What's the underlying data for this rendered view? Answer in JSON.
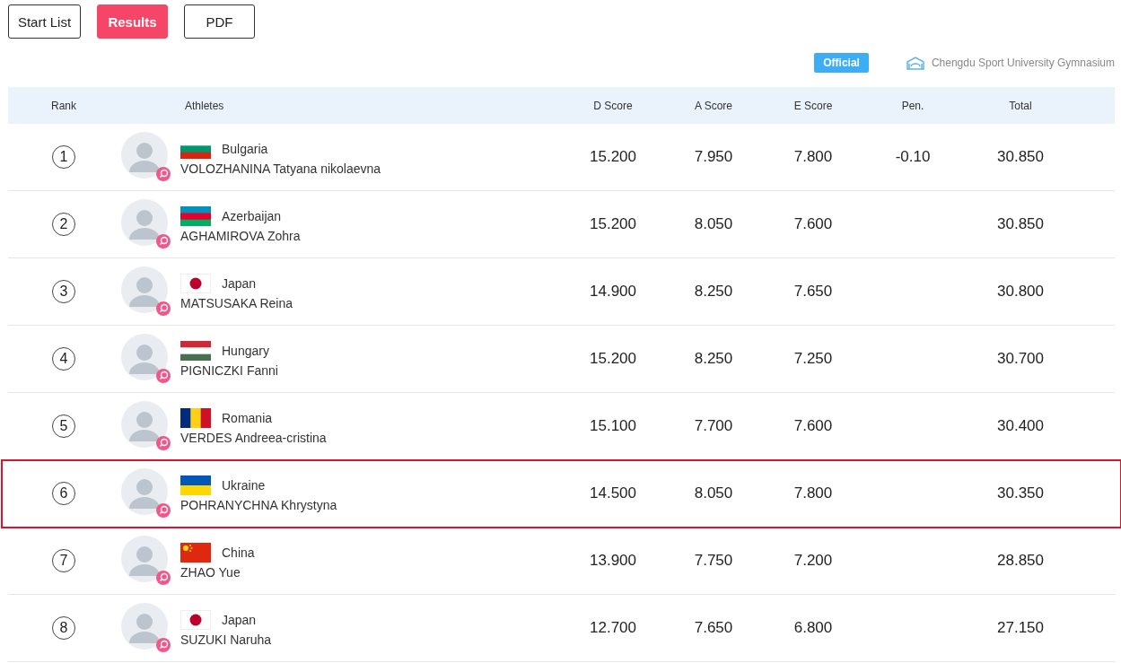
{
  "buttons": [
    {
      "label": "Start List",
      "selected": false
    },
    {
      "label": "Results",
      "selected": true
    },
    {
      "label": "PDF",
      "selected": false
    }
  ],
  "status_badge": "Official",
  "venue": "Chengdu Sport University Gymnasium",
  "table": {
    "columns": [
      "Rank",
      "Athletes",
      "D Score",
      "A Score",
      "E Score",
      "Pen.",
      "Total"
    ],
    "rows": [
      {
        "rank": "1",
        "country": "Bulgaria",
        "kind": "bg",
        "name": "VOLOZHANINA Tatyana nikolaevna",
        "d_score": "15.200",
        "a_score": "7.950",
        "e_score": "7.800",
        "pen": "-0.10",
        "total": "30.850",
        "highlighted": false
      },
      {
        "rank": "2",
        "country": "Azerbaijan",
        "kind": "az",
        "name": "AGHAMIROVA Zohra",
        "d_score": "15.200",
        "a_score": "8.050",
        "e_score": "7.600",
        "total": "30.850",
        "highlighted": false
      },
      {
        "rank": "3",
        "country": "Japan",
        "kind": "jp",
        "name": "MATSUSAKA Reina",
        "d_score": "14.900",
        "a_score": "8.250",
        "e_score": "7.650",
        "total": "30.800",
        "highlighted": false
      },
      {
        "rank": "4",
        "country": "Hungary",
        "kind": "hu",
        "name": "PIGNICZKI Fanni",
        "d_score": "15.200",
        "a_score": "8.250",
        "e_score": "7.250",
        "total": "30.700",
        "highlighted": false
      },
      {
        "rank": "5",
        "country": "Romania",
        "kind": "ro",
        "name": "VERDES Andreea-cristina",
        "d_score": "15.100",
        "a_score": "7.700",
        "e_score": "7.600",
        "total": "30.400",
        "highlighted": false
      },
      {
        "rank": "6",
        "country": "Ukraine",
        "kind": "ua",
        "name": "POHRANYCHNA Khrystyna",
        "d_score": "14.500",
        "a_score": "8.050",
        "e_score": "7.800",
        "total": "30.350",
        "highlighted": true
      },
      {
        "rank": "7",
        "country": "China",
        "kind": "cn",
        "name": "ZHAO Yue",
        "d_score": "13.900",
        "a_score": "7.750",
        "e_score": "7.200",
        "total": "28.850",
        "highlighted": false
      },
      {
        "rank": "8",
        "country": "Japan",
        "kind": "jp",
        "name": "SUZUKI Naruha",
        "d_score": "12.700",
        "a_score": "7.650",
        "e_score": "6.800",
        "total": "27.150",
        "highlighted": false
      }
    ]
  }
}
